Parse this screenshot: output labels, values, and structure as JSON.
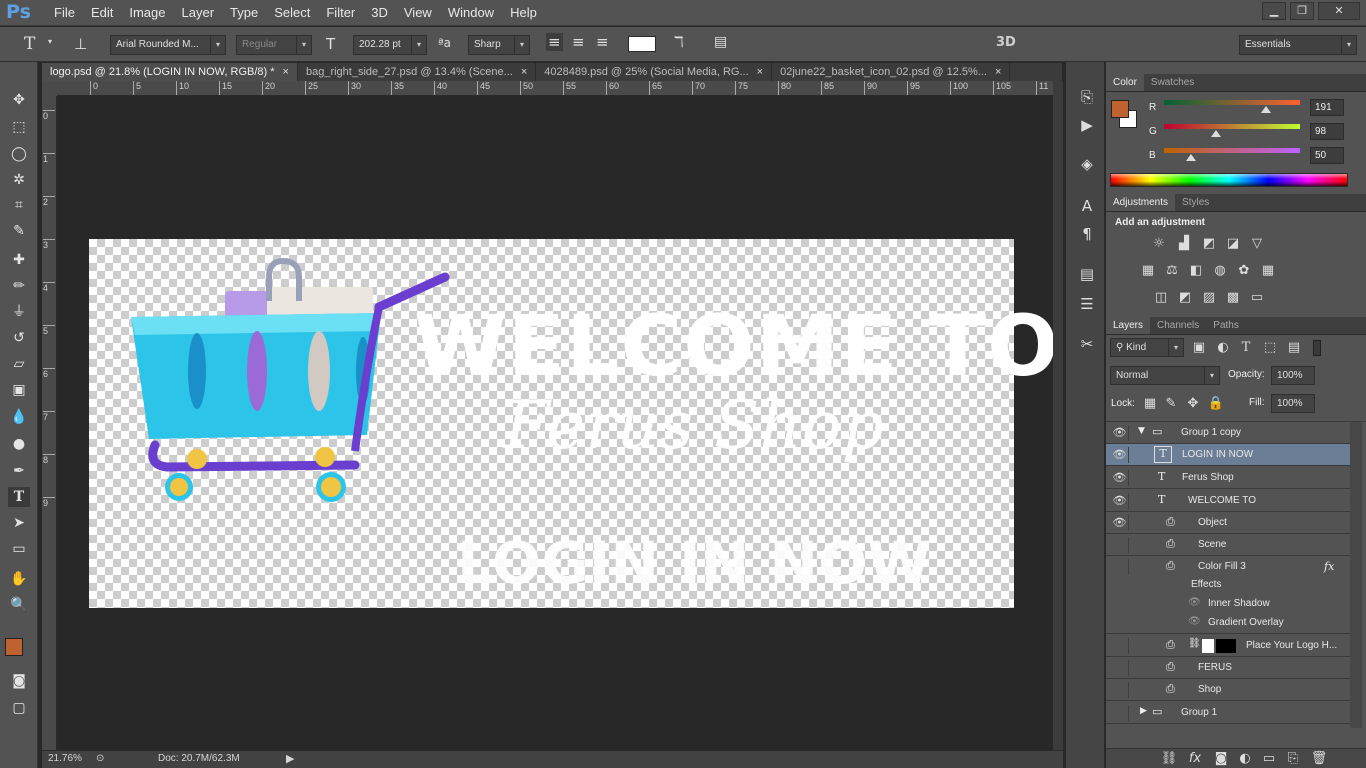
{
  "app": {
    "logo": "Ps"
  },
  "menu": [
    "File",
    "Edit",
    "Image",
    "Layer",
    "Type",
    "Select",
    "Filter",
    "3D",
    "View",
    "Window",
    "Help"
  ],
  "window_controls": {
    "minimize": "▁",
    "restore": "❐",
    "close": "✕"
  },
  "options": {
    "font_family": "Arial Rounded M...",
    "font_style": "Regular",
    "font_size": "202.28 pt",
    "antialias": "Sharp",
    "threed": "3D",
    "workspace": "Essentials",
    "text_color": "#ffffff"
  },
  "tabs": [
    {
      "label": "logo.psd @ 21.8% (LOGIN IN NOW, RGB/8) *",
      "close": "×"
    },
    {
      "label": "bag_right_side_27.psd @ 13.4% (Scene...",
      "close": "×"
    },
    {
      "label": "4028489.psd @ 25% (Social Media, RG...",
      "close": "×"
    },
    {
      "label": "02june22_basket_icon_02.psd @ 12.5%...",
      "close": "×"
    }
  ],
  "ruler_h": [
    "0",
    "5",
    "10",
    "15",
    "20",
    "25",
    "30",
    "35",
    "40",
    "45",
    "50",
    "55",
    "60",
    "65",
    "70",
    "75",
    "80",
    "85",
    "90",
    "95",
    "100",
    "105",
    "11"
  ],
  "ruler_v": [
    "0",
    "1",
    "2",
    "3",
    "4",
    "5",
    "6",
    "7",
    "8",
    "9"
  ],
  "canvas": {
    "welcome": "WELCOME TO",
    "ferus": "Ferus Shop",
    "login": "LOGIN IN NOW"
  },
  "status": {
    "zoom": "21.76%",
    "doc": "Doc: 20.7M/62.3M"
  },
  "colors": {
    "foreground": "#bf6232",
    "background": "#ffffff"
  },
  "color_panel": {
    "tabs": [
      "Color",
      "Swatches"
    ],
    "r_label": "R",
    "g_label": "G",
    "b_label": "B",
    "r": "191",
    "g": "98",
    "b": "50",
    "r_fraction": 0.749,
    "g_fraction": 0.384,
    "b_fraction": 0.196
  },
  "adjustments": {
    "tabs": [
      "Adjustments",
      "Styles"
    ],
    "title": "Add an adjustment"
  },
  "layers_panel": {
    "tabs": [
      "Layers",
      "Channels",
      "Paths"
    ],
    "kind": "Kind",
    "blend": "Normal",
    "opacity_label": "Opacity:",
    "opacity": "100%",
    "lock_label": "Lock:",
    "fill_label": "Fill:",
    "fill": "100%",
    "fx": "fx",
    "layers": [
      {
        "name": "Group 1 copy",
        "visible": true,
        "kind": "group-open"
      },
      {
        "name": "LOGIN IN NOW",
        "visible": true,
        "kind": "text",
        "selected": true
      },
      {
        "name": "Ferus Shop",
        "visible": true,
        "kind": "text"
      },
      {
        "name": "WELCOME TO",
        "visible": true,
        "kind": "text"
      },
      {
        "name": "Object",
        "visible": true,
        "kind": "smart"
      },
      {
        "name": "Scene",
        "visible": false,
        "kind": "smart"
      },
      {
        "name": "Color Fill 3",
        "visible": false,
        "kind": "smart"
      },
      {
        "name": "Effects",
        "visible": false,
        "kind": "effects"
      },
      {
        "name": "Inner Shadow",
        "visible": false,
        "kind": "effect"
      },
      {
        "name": "Gradient Overlay",
        "visible": false,
        "kind": "effect"
      },
      {
        "name": "Place Your Logo H...",
        "visible": false,
        "kind": "masked"
      },
      {
        "name": "FERUS",
        "visible": false,
        "kind": "smart"
      },
      {
        "name": "Shop",
        "visible": false,
        "kind": "smart"
      },
      {
        "name": "Group 1",
        "visible": false,
        "kind": "group-closed"
      }
    ]
  }
}
